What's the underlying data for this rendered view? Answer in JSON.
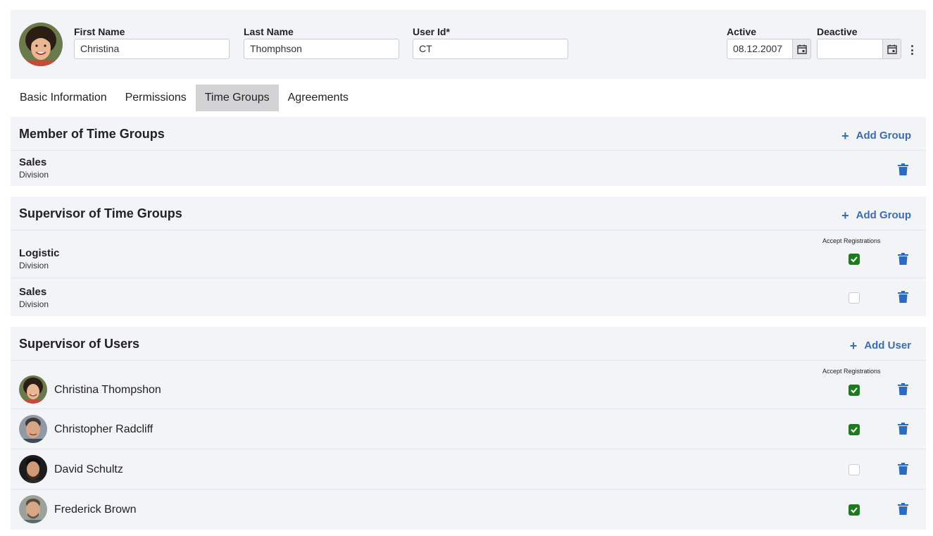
{
  "header": {
    "first_name_label": "First Name",
    "first_name_value": "Christina",
    "last_name_label": "Last Name",
    "last_name_value": "Thomphson",
    "user_id_label": "User Id*",
    "user_id_value": "CT",
    "active_label": "Active",
    "active_value": "08.12.2007",
    "deactive_label": "Deactive",
    "deactive_value": ""
  },
  "tabs": [
    {
      "label": "Basic Information",
      "active": false
    },
    {
      "label": "Permissions",
      "active": false
    },
    {
      "label": "Time Groups",
      "active": true
    },
    {
      "label": "Agreements",
      "active": false
    }
  ],
  "member_groups": {
    "title": "Member of Time Groups",
    "add_label": "Add Group",
    "items": [
      {
        "name": "Sales",
        "type": "Division"
      }
    ]
  },
  "supervisor_groups": {
    "title": "Supervisor of Time Groups",
    "add_label": "Add Group",
    "accept_label": "Accept Registrations",
    "items": [
      {
        "name": "Logistic",
        "type": "Division",
        "accept": true
      },
      {
        "name": "Sales",
        "type": "Division",
        "accept": false
      }
    ]
  },
  "supervisor_users": {
    "title": "Supervisor of Users",
    "add_label": "Add User",
    "accept_label": "Accept Registrations",
    "items": [
      {
        "name": "Christina Thompshon",
        "accept": true
      },
      {
        "name": "Christopher Radcliff",
        "accept": true
      },
      {
        "name": "David Schultz",
        "accept": false
      },
      {
        "name": "Frederick Brown",
        "accept": true
      }
    ]
  },
  "colors": {
    "accent": "#3a6cb4",
    "trash": "#2a6bc4",
    "check": "#1e7a1e",
    "panel_bg": "#f3f4f8",
    "tab_active": "#d3d3d5"
  },
  "icons": {
    "calendar": "calendar-icon",
    "more": "more-vertical-icon",
    "add": "plus-icon",
    "delete": "trash-icon",
    "check": "check-icon"
  }
}
